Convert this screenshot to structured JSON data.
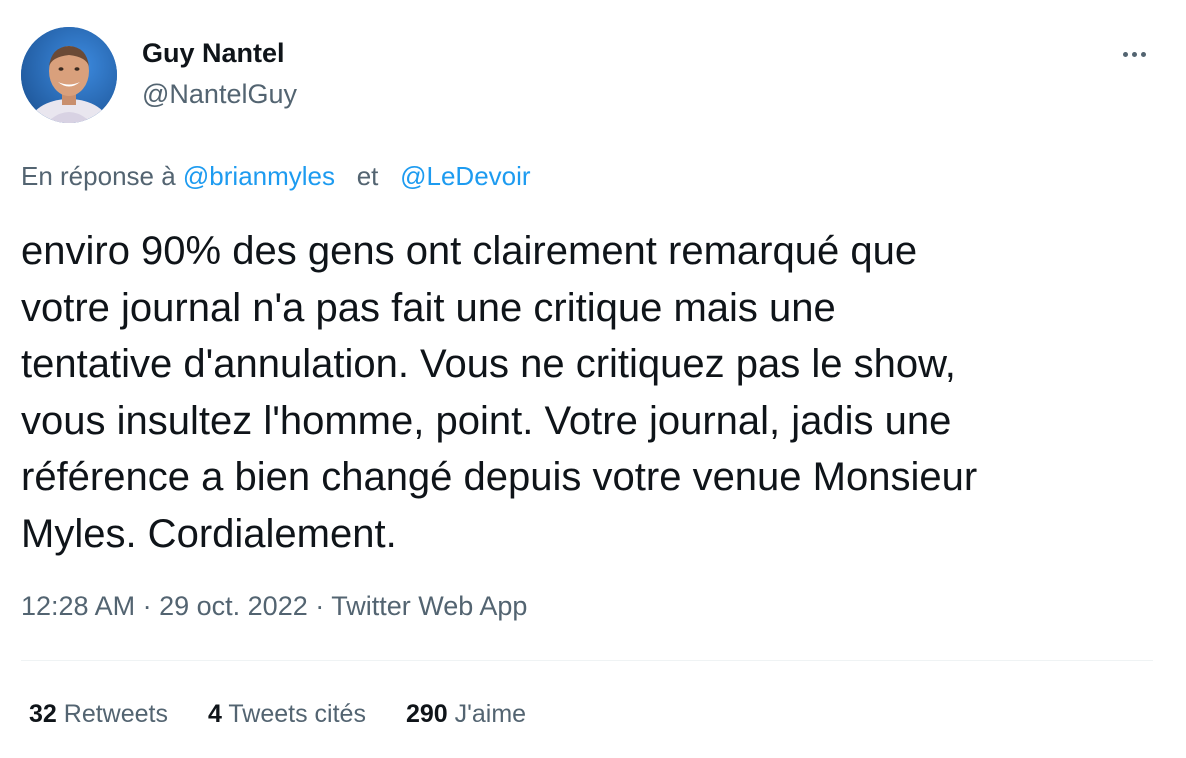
{
  "author": {
    "name": "Guy Nantel",
    "handle": "@NantelGuy"
  },
  "reply": {
    "prefix": "En réponse à",
    "mention1": "@brianmyles",
    "joiner": "et",
    "mention2": "@LeDevoir"
  },
  "tweet": {
    "text": "enviro 90% des gens ont clairement remarqué que\nvotre journal n'a pas fait une critique mais une\ntentative d'annulation. Vous ne critiquez pas le show,\nvous insultez l'homme, point. Votre journal, jadis une\nréférence a bien changé depuis votre venue Monsieur\nMyles. Cordialement.",
    "time": "12:28 AM",
    "dot1": "·",
    "date": "29 oct. 2022",
    "dot2": "·",
    "source": "Twitter Web App"
  },
  "stats": {
    "retweets_count": "32",
    "retweets_label": "Retweets",
    "quotes_count": "4",
    "quotes_label": "Tweets cités",
    "likes_count": "290",
    "likes_label": "J'aime"
  },
  "icons": {
    "more": "more-horizontal-icon"
  },
  "colors": {
    "link": "#1d9bf0",
    "secondary": "#536471",
    "primary": "#0f1419"
  }
}
